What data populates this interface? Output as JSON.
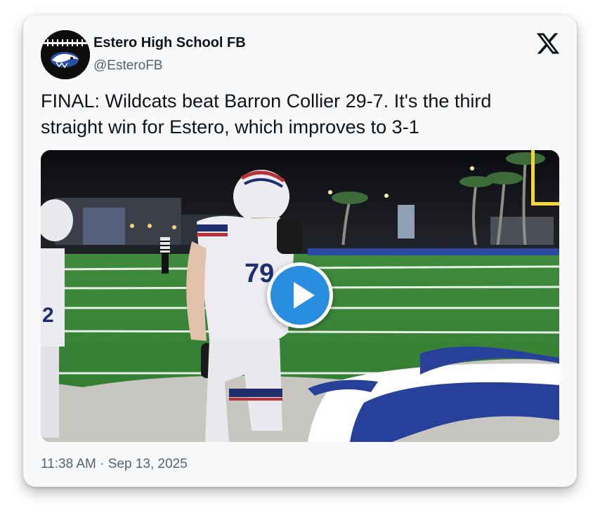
{
  "tweet": {
    "author": {
      "display_name": "Estero High School FB",
      "handle": "@EsteroFB",
      "avatar_icon": "wildcat-football-logo"
    },
    "brand_icon": "x-logo-icon",
    "text": "FINAL: Wildcats beat Barron Collier 29-7. It's the third straight win for Estero, which improves to 3-1",
    "media": {
      "type": "video",
      "play_icon": "play-icon",
      "accent_color": "#2a8ee0"
    },
    "timestamp": "11:38 AM · Sep 13, 2025"
  }
}
